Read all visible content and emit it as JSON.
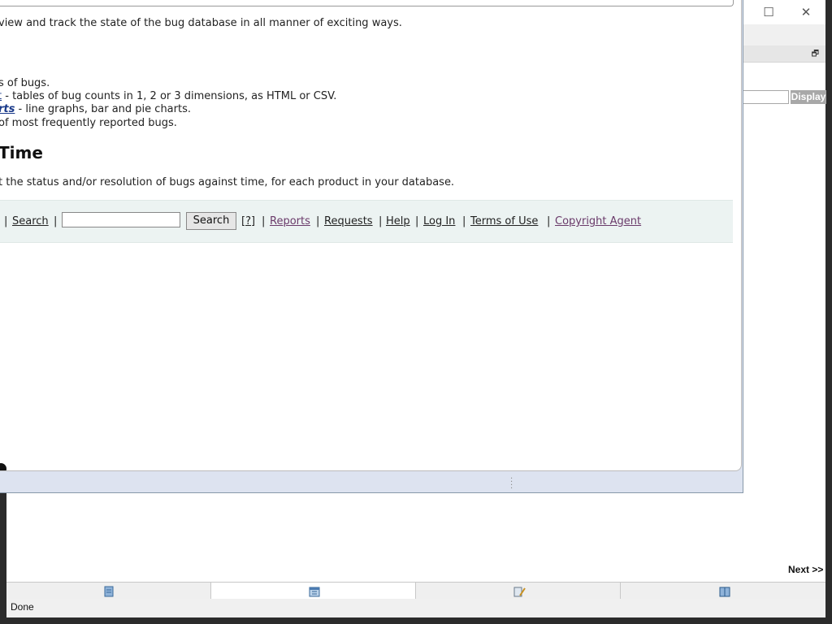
{
  "background_window": {
    "display_button": "Display",
    "next_link": "Next >>",
    "status_text": "Done",
    "tabs": [
      {
        "icon": "document-icon"
      },
      {
        "icon": "calendar-icon",
        "active": true
      },
      {
        "icon": "tools-icon"
      },
      {
        "icon": "book-icon"
      }
    ]
  },
  "popup": {
    "intro_text": "view and track the state of the bug database in all manner of exciting ways.",
    "list": {
      "item1_text": "s of bugs.",
      "item2_link": "t",
      "item2_text": " - tables of bug counts in 1, 2 or 3 dimensions, as HTML or CSV.",
      "item3_link": "rts",
      "item3_text": " - line graphs, bar and pie charts.",
      "item4_text": " of most frequently reported bugs."
    },
    "heading": "Time",
    "heading_desc": "t the status and/or resolution of bugs against time, for each product in your database.",
    "footer": {
      "sep0": "|",
      "search_link": "Search",
      "sep1": "|",
      "search_button": "Search",
      "help_q": "[?]",
      "sep2": "|",
      "reports": "Reports",
      "sep3": "|",
      "requests": "Requests",
      "sep4": "|",
      "help": "Help",
      "sep5": "|",
      "login": "Log In",
      "sep6": "|",
      "terms": "Terms of Use",
      "sep7": "|",
      "copyright": "Copyright Agent"
    }
  }
}
